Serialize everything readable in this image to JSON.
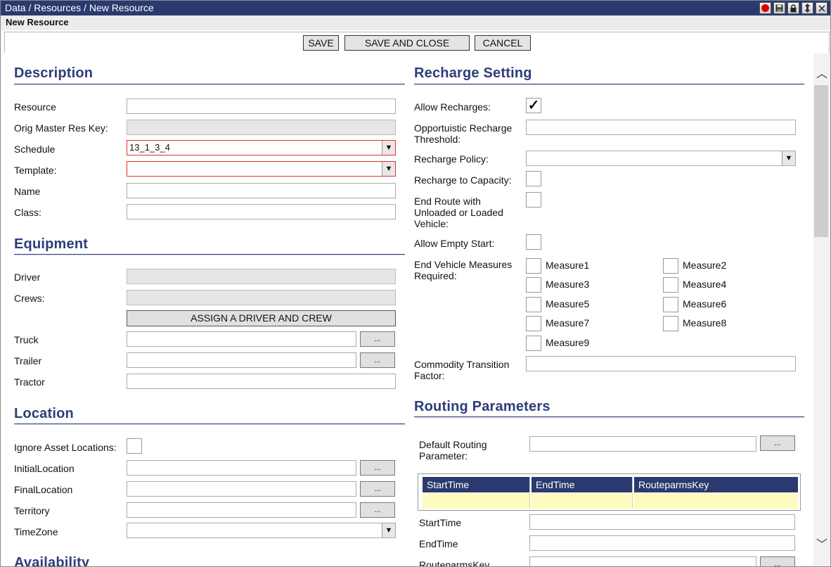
{
  "window": {
    "title": "Data / Resources / New Resource",
    "subtitle": "New Resource"
  },
  "toolbar": {
    "save": "SAVE",
    "save_close": "SAVE AND CLOSE",
    "cancel": "CANCEL"
  },
  "description": {
    "title": "Description",
    "resource_label": "Resource",
    "resource_value": "",
    "orig_key_label": "Orig Master Res Key:",
    "orig_key_value": "",
    "schedule_label": "Schedule",
    "schedule_value": "13_1_3_4",
    "template_label": "Template:",
    "template_value": "",
    "name_label": "Name",
    "name_value": "",
    "class_label": "Class:",
    "class_value": ""
  },
  "equipment": {
    "title": "Equipment",
    "driver_label": "Driver",
    "driver_value": "",
    "crews_label": "Crews:",
    "crews_value": "",
    "assign_button": "ASSIGN A DRIVER AND CREW",
    "truck_label": "Truck",
    "truck_value": "",
    "trailer_label": "Trailer",
    "trailer_value": "",
    "tractor_label": "Tractor",
    "tractor_value": "",
    "ellipsis": "..."
  },
  "location": {
    "title": "Location",
    "ignore_label": "Ignore Asset Locations:",
    "initial_label": "InitialLocation",
    "initial_value": "",
    "final_label": "FinalLocation",
    "final_value": "",
    "territory_label": "Territory",
    "territory_value": "",
    "timezone_label": "TimeZone",
    "timezone_value": ""
  },
  "availability": {
    "title": "Availability"
  },
  "recharge": {
    "title": "Recharge Setting",
    "allow_label": "Allow Recharges:",
    "allow_checked": true,
    "check_glyph": "✓",
    "threshold_label": "Opportuistic Recharge Threshold:",
    "threshold_value": "",
    "policy_label": "Recharge Policy:",
    "policy_value": "",
    "capacity_label": "Recharge to Capacity:",
    "end_route_label": "End Route with Unloaded or Loaded Vehicle:",
    "empty_start_label": "Allow Empty Start:",
    "measures_label": "End Vehicle Measures Required:",
    "measures": [
      "Measure1",
      "Measure2",
      "Measure3",
      "Measure4",
      "Measure5",
      "Measure6",
      "Measure7",
      "Measure8",
      "Measure9"
    ],
    "commodity_label": "Commodity Transition Factor:",
    "commodity_value": ""
  },
  "routing": {
    "title": "Routing Parameters",
    "default_label": "Default Routing Parameter:",
    "default_value": "",
    "columns": [
      "StartTime",
      "EndTime",
      "RouteparmsKey"
    ],
    "start_label": "StartTime",
    "start_value": "",
    "end_label": "EndTime",
    "end_value": "",
    "key_label": "RouteparmsKey",
    "key_value": ""
  },
  "icons": {
    "record": "record-icon",
    "save": "floppy-disk-icon",
    "lock": "lock-icon",
    "resize": "resize-icon",
    "close": "close-icon",
    "dropdown": "▼",
    "scroll_up": "︿",
    "scroll_down": "﹀"
  },
  "colors": {
    "titlebar": "#2a3a6e",
    "section": "#2e3d7a",
    "required": "#e03030",
    "grid_row": "#fffbbf"
  }
}
